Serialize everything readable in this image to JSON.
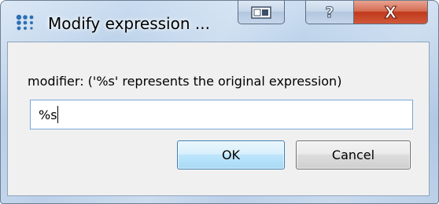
{
  "window": {
    "title": "Modify expression ...",
    "app_icon": "dots-grid-icon",
    "controls": {
      "extra_icon": "window-layout-icon",
      "help_label": "?",
      "close_label": "X"
    }
  },
  "dialog": {
    "prompt": "modifier: ('%s' represents the original expression)",
    "input_value": "%s",
    "ok_label": "OK",
    "cancel_label": "Cancel"
  },
  "colors": {
    "close_button": "#c7432a",
    "input_border": "#7aa7d8",
    "ok_border": "#3c7fb1",
    "app_icon": "#2f6fb3"
  }
}
